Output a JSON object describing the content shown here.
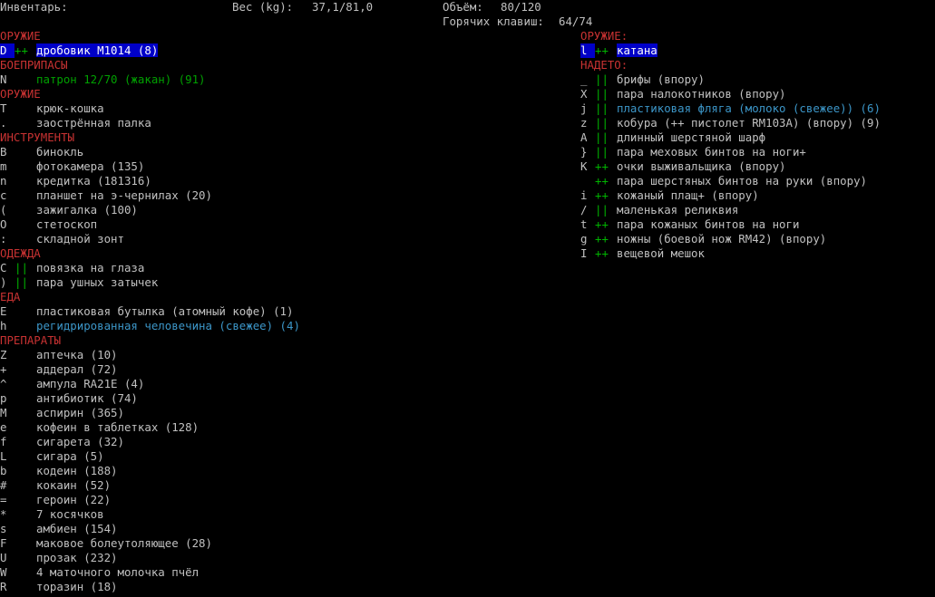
{
  "colors": {
    "background": "#000000",
    "text": "#c0c0c0",
    "category": "#c83232",
    "marker_green": "#00b400",
    "selection_bg": "#0000c8",
    "ammo": "#00a000",
    "cyan": "#3c96c8"
  },
  "header": {
    "title": "Инвентарь:",
    "weight_label": "Вес (kg):",
    "weight_value": "37,1/81,0",
    "volume_label": "Объём:",
    "volume_value": "80/120",
    "hotkeys_label": "Горячих клавиш:",
    "hotkeys_value": "64/74"
  },
  "left_column": [
    {
      "type": "category",
      "label": "ОРУЖИЕ"
    },
    {
      "type": "item",
      "letter": "D",
      "prefix": "++",
      "text": "дробовик M1014 (8)",
      "selected": true
    },
    {
      "type": "category",
      "label": "БОЕПРИПАСЫ"
    },
    {
      "type": "item",
      "letter": "N",
      "prefix": "",
      "text": "патрон 12/70 (жакан) (91)",
      "color": "#00a000"
    },
    {
      "type": "category",
      "label": "ОРУЖИЕ"
    },
    {
      "type": "item",
      "letter": "T",
      "prefix": "",
      "text": "крюк-кошка"
    },
    {
      "type": "item",
      "letter": ".",
      "prefix": "",
      "text": "заострённая палка"
    },
    {
      "type": "category",
      "label": "ИНСТРУМЕНТЫ"
    },
    {
      "type": "item",
      "letter": "B",
      "prefix": "",
      "text": "бинокль"
    },
    {
      "type": "item",
      "letter": "m",
      "prefix": "",
      "text": "фотокамера (135)"
    },
    {
      "type": "item",
      "letter": "n",
      "prefix": "",
      "text": "кредитка (181316)"
    },
    {
      "type": "item",
      "letter": "c",
      "prefix": "",
      "text": "планшет на э-чернилах (20)"
    },
    {
      "type": "item",
      "letter": "(",
      "prefix": "",
      "text": "зажигалка (100)"
    },
    {
      "type": "item",
      "letter": "O",
      "prefix": "",
      "text": "стетоскоп"
    },
    {
      "type": "item",
      "letter": ":",
      "prefix": "",
      "text": "складной зонт"
    },
    {
      "type": "category",
      "label": "ОДЕЖДА"
    },
    {
      "type": "item",
      "letter": "C",
      "prefix": "||",
      "text": "повязка на глаза"
    },
    {
      "type": "item",
      "letter": ")",
      "prefix": "||",
      "text": "пара ушных затычек"
    },
    {
      "type": "category",
      "label": "ЕДА"
    },
    {
      "type": "item",
      "letter": "E",
      "prefix": "",
      "text": "пластиковая бутылка (атомный кофе) (1)"
    },
    {
      "type": "item",
      "letter": "h",
      "prefix": "",
      "text": "регидрированная человечина (свежее) (4)",
      "color": "#3c96c8"
    },
    {
      "type": "category",
      "label": "ПРЕПАРАТЫ"
    },
    {
      "type": "item",
      "letter": "Z",
      "prefix": "",
      "text": "аптечка (10)"
    },
    {
      "type": "item",
      "letter": "+",
      "prefix": "",
      "text": "аддерал (72)"
    },
    {
      "type": "item",
      "letter": "^",
      "prefix": "",
      "text": "ампула RA21E (4)"
    },
    {
      "type": "item",
      "letter": "p",
      "prefix": "",
      "text": "антибиотик (74)"
    },
    {
      "type": "item",
      "letter": "M",
      "prefix": "",
      "text": "аспирин (365)"
    },
    {
      "type": "item",
      "letter": "e",
      "prefix": "",
      "text": "кофеин в таблетках (128)"
    },
    {
      "type": "item",
      "letter": "f",
      "prefix": "",
      "text": "сигарета (32)"
    },
    {
      "type": "item",
      "letter": "L",
      "prefix": "",
      "text": "сигара (5)"
    },
    {
      "type": "item",
      "letter": "b",
      "prefix": "",
      "text": "кодеин (188)"
    },
    {
      "type": "item",
      "letter": "#",
      "prefix": "",
      "text": "кокаин (52)"
    },
    {
      "type": "item",
      "letter": "=",
      "prefix": "",
      "text": "героин (22)"
    },
    {
      "type": "item",
      "letter": "*",
      "prefix": "",
      "text": "7 косячков"
    },
    {
      "type": "item",
      "letter": "s",
      "prefix": "",
      "text": "амбиен (154)"
    },
    {
      "type": "item",
      "letter": "F",
      "prefix": "",
      "text": "маковое болеутоляющее (28)"
    },
    {
      "type": "item",
      "letter": "U",
      "prefix": "",
      "text": "прозак (232)"
    },
    {
      "type": "item",
      "letter": "W",
      "prefix": "",
      "text": "4 маточного молочка пчёл"
    },
    {
      "type": "item",
      "letter": "R",
      "prefix": "",
      "text": "торазин (18)"
    }
  ],
  "right_column": [
    {
      "type": "category",
      "label": "ОРУЖИЕ:"
    },
    {
      "type": "item",
      "letter": "l",
      "prefix": "++",
      "text": "катана",
      "selected": true
    },
    {
      "type": "category",
      "label": "НАДЕТО:"
    },
    {
      "type": "item",
      "letter": "_",
      "prefix": "||",
      "text": "брифы (впору)"
    },
    {
      "type": "item",
      "letter": "X",
      "prefix": "||",
      "text": "пара налокотников (впору)"
    },
    {
      "type": "item",
      "letter": "j",
      "prefix": "||",
      "text": "пластиковая фляга (молоко (свежее)) (6)",
      "color": "#3c96c8"
    },
    {
      "type": "item",
      "letter": "z",
      "prefix": "||",
      "text": "кобура (++ пистолет RM103A) (впору) (9)"
    },
    {
      "type": "item",
      "letter": "A",
      "prefix": "||",
      "text": "длинный шерстяной шарф"
    },
    {
      "type": "item",
      "letter": "}",
      "prefix": "||",
      "text": "пара меховых бинтов на ноги+"
    },
    {
      "type": "item",
      "letter": "K",
      "prefix": "++",
      "text": "очки выживальщика (впору)"
    },
    {
      "type": "item",
      "letter": "",
      "prefix": "++",
      "text": "пара шерстяных бинтов на руки (впору)"
    },
    {
      "type": "item",
      "letter": "i",
      "prefix": "++",
      "text": "кожаный плащ+ (впору)"
    },
    {
      "type": "item",
      "letter": "/",
      "prefix": "||",
      "text": "маленькая реликвия"
    },
    {
      "type": "item",
      "letter": "t",
      "prefix": "++",
      "text": "пара кожаных бинтов на ноги"
    },
    {
      "type": "item",
      "letter": "g",
      "prefix": "++",
      "text": "ножны (боевой нож RM42) (впору)"
    },
    {
      "type": "item",
      "letter": "I",
      "prefix": "++",
      "text": "вещевой мешок"
    }
  ]
}
